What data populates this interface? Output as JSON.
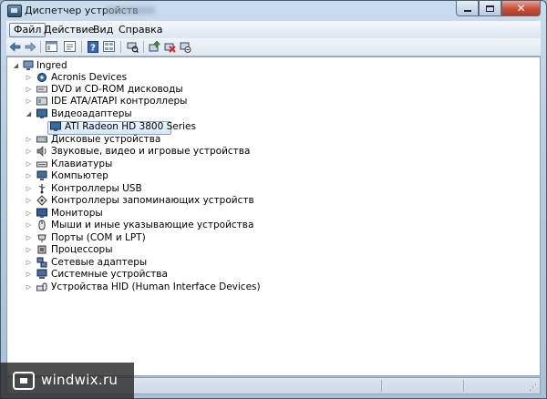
{
  "window": {
    "title": "Диспетчер устройств",
    "close_label": "✕"
  },
  "menu": {
    "items": [
      "Файл",
      "Действие",
      "Вид",
      "Справка"
    ]
  },
  "toolbar": {
    "icons": [
      "back-arrow-icon",
      "forward-arrow-icon",
      "show-hide-console-tree-icon",
      "properties-icon",
      "help-icon",
      "view-icon",
      "scan-hardware-icon",
      "update-driver-icon",
      "uninstall-device-icon",
      "disable-device-icon"
    ]
  },
  "tree": {
    "root": "Ingred",
    "items": [
      "Acronis Devices",
      "DVD и CD-ROM дисководы",
      "IDE ATA/ATAPI контроллеры",
      "Видеоадаптеры",
      "ATI Radeon HD 3800 Series",
      "Дисковые устройства",
      "Звуковые, видео и игровые устройства",
      "Клавиатуры",
      "Компьютер",
      "Контроллеры USB",
      "Контроллеры запоминающих устройств",
      "Мониторы",
      "Мыши и иные указывающие устройства",
      "Порты (COM и LPT)",
      "Процессоры",
      "Сетевые адаптеры",
      "Системные устройства",
      "Устройства HID (Human Interface Devices)"
    ],
    "expanded": "Видеоадаптеры",
    "selected": "ATI Radeon HD 3800 Series"
  },
  "watermark": {
    "text": "windwix.ru"
  },
  "colors": {
    "selection_border": "#7da2ce",
    "titlebar": "#b4cbe0",
    "close_button": "#c74e35"
  }
}
